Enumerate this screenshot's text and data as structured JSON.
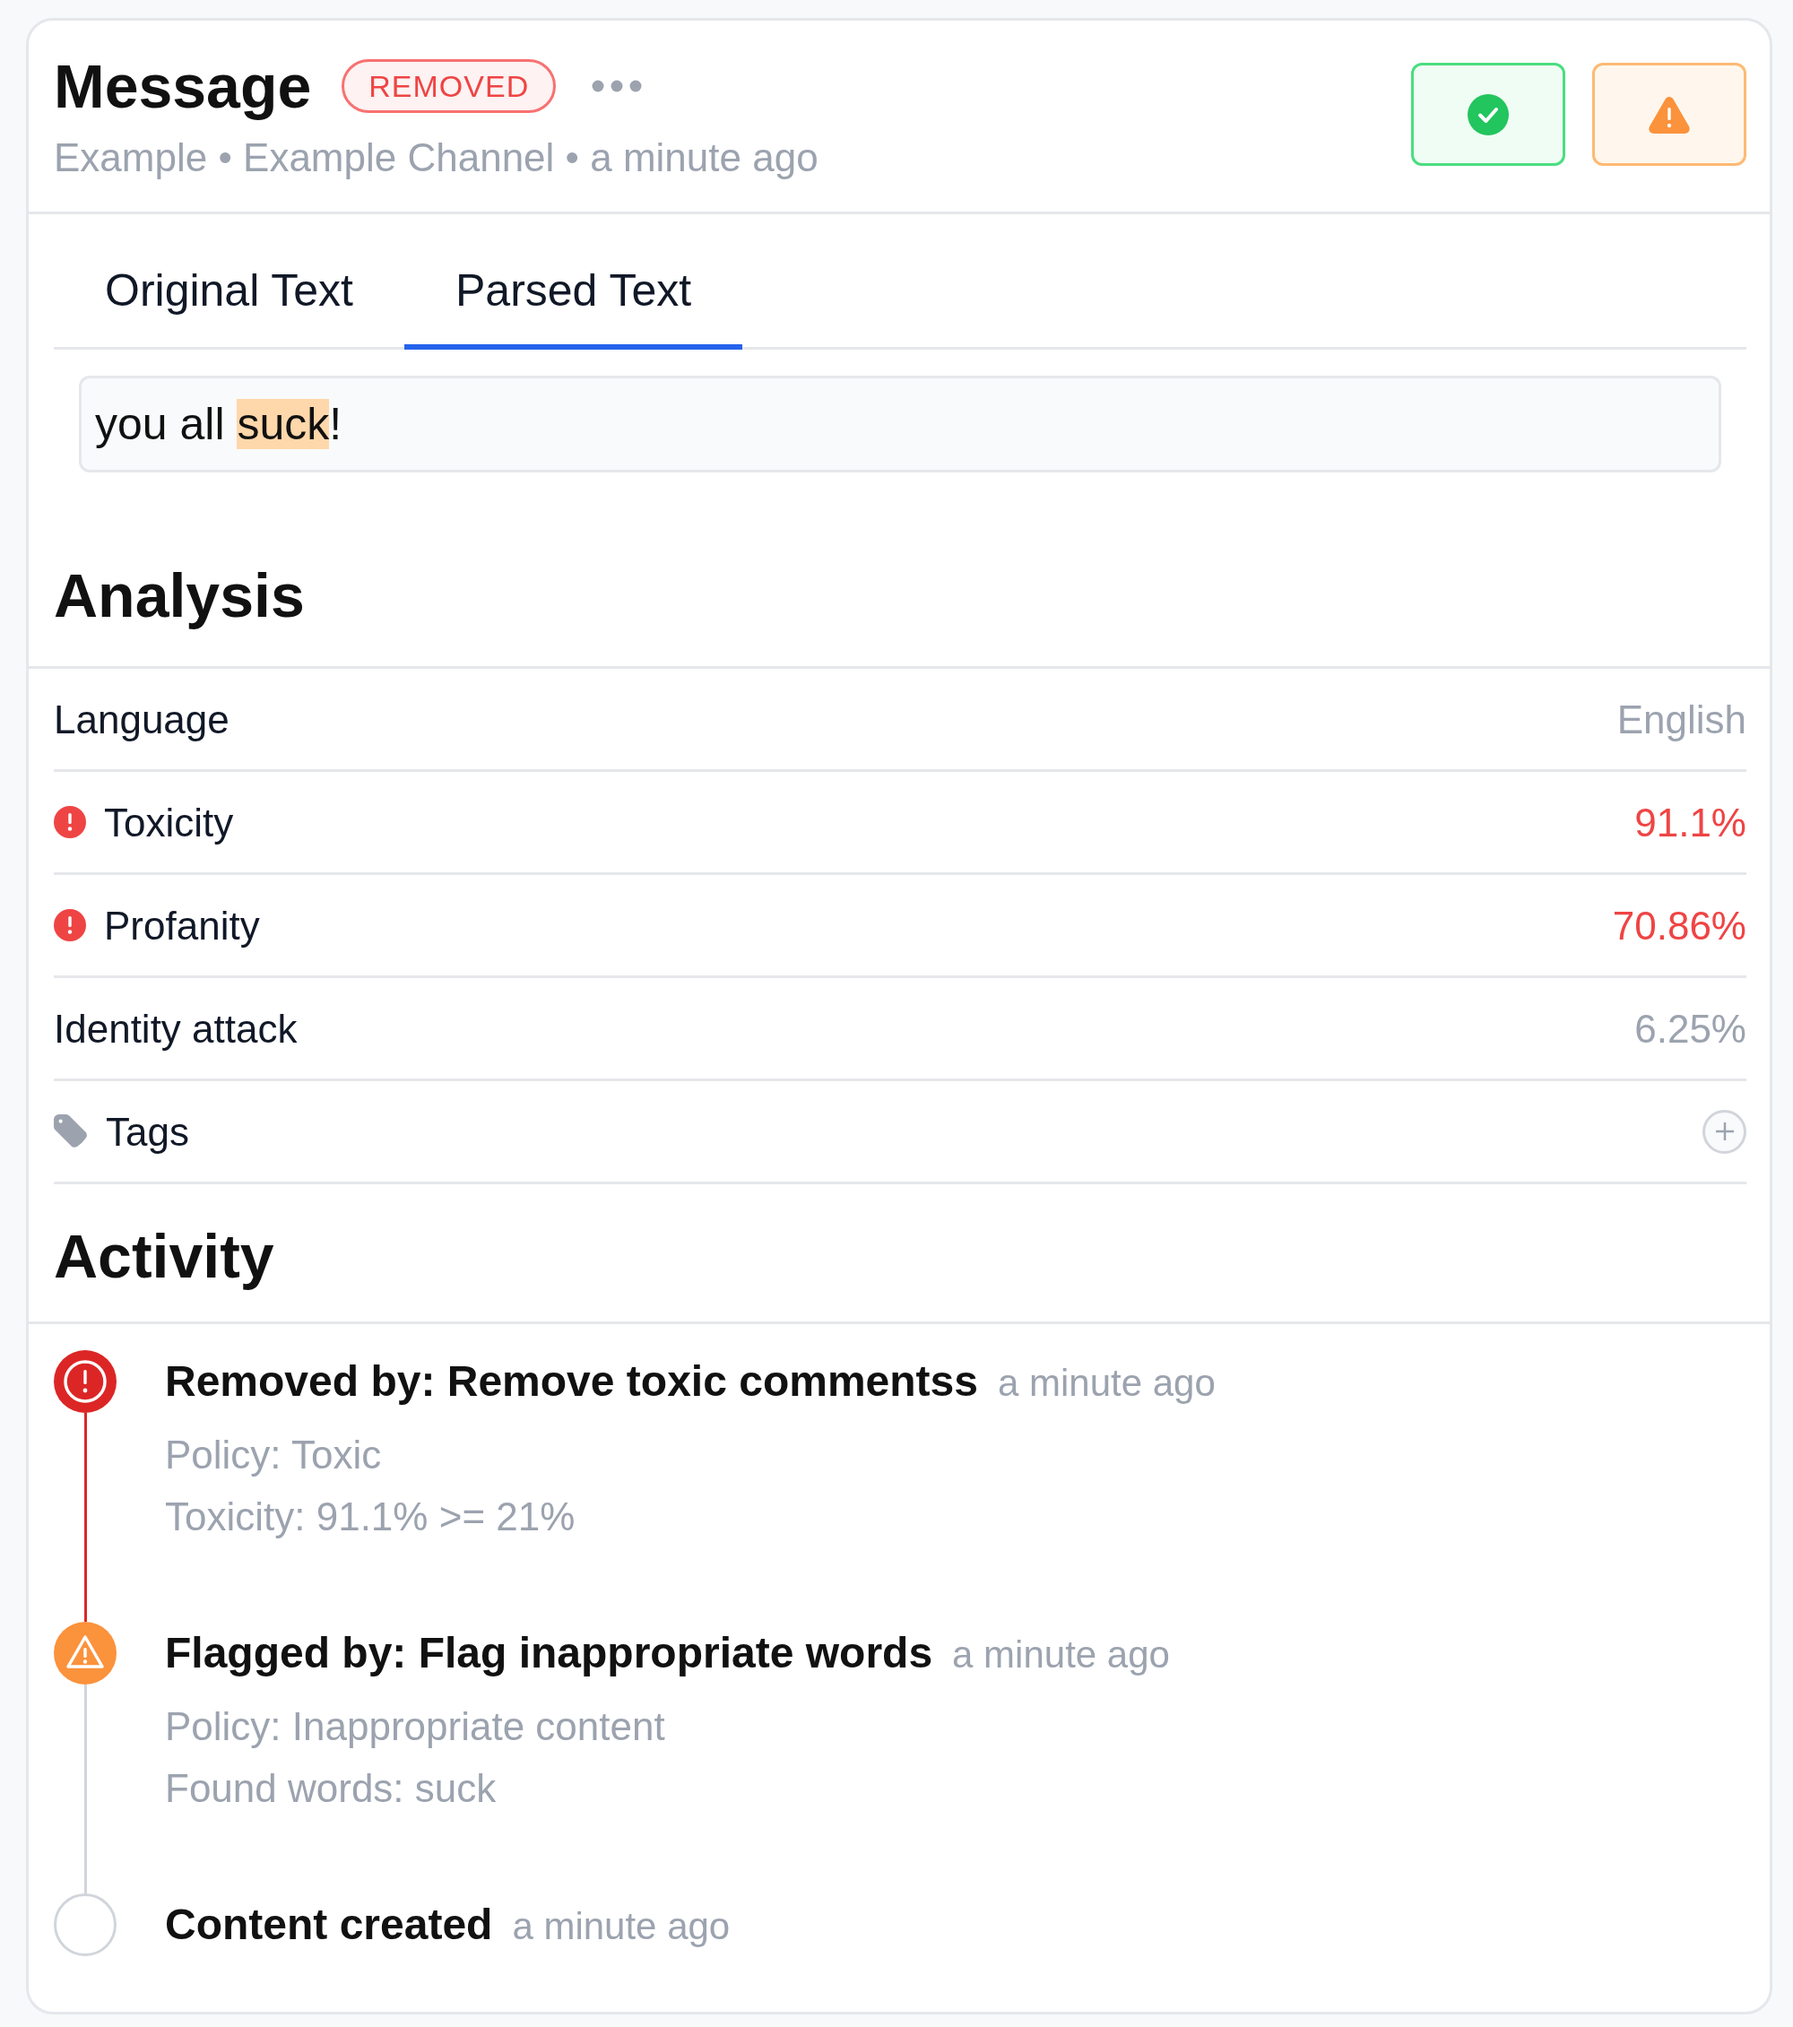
{
  "header": {
    "title": "Message",
    "status": "REMOVED",
    "meta": "Example • Example Channel • a minute ago",
    "actions": [
      {
        "kind": "approve"
      },
      {
        "kind": "flag"
      }
    ]
  },
  "tabs": [
    {
      "label": "Original Text",
      "selected": false
    },
    {
      "label": "Parsed Text",
      "selected": true
    }
  ],
  "parsed_text": {
    "segments": [
      {
        "text": "you all ",
        "highlighted": false
      },
      {
        "text": "suck",
        "highlighted": true
      },
      {
        "text": "!",
        "highlighted": false
      }
    ]
  },
  "analysis": {
    "title": "Analysis",
    "rows": [
      {
        "label": "Language",
        "value": "English",
        "flagged": false
      },
      {
        "label": "Toxicity",
        "value": "91.1%",
        "flagged": true
      },
      {
        "label": "Profanity",
        "value": "70.86%",
        "flagged": true
      },
      {
        "label": "Identity attack",
        "value": "6.25%",
        "flagged": false
      }
    ],
    "tags": {
      "label": "Tags"
    }
  },
  "activity": {
    "title": "Activity",
    "events": [
      {
        "kind": "removed",
        "title": "Removed by: Remove toxic commentss",
        "time": "a minute ago",
        "details": [
          "Policy: Toxic",
          "Toxicity: 91.1% >= 21%"
        ]
      },
      {
        "kind": "flagged",
        "title": "Flagged by: Flag inappropriate words",
        "time": "a minute ago",
        "details": [
          "Policy: Inappropriate content",
          "Found words: suck"
        ]
      },
      {
        "kind": "created",
        "title": "Content created",
        "time": "a minute ago"
      }
    ]
  }
}
